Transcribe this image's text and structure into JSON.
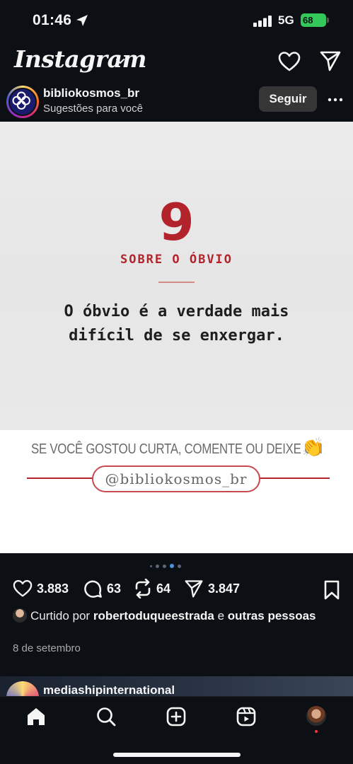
{
  "status_bar": {
    "time": "01:46",
    "network": "5G",
    "battery": "68"
  },
  "app_header": {
    "logo": "Instagram"
  },
  "post": {
    "username": "bibliokosmos_br",
    "subtitle": "Sugestões para você",
    "follow_label": "Seguir",
    "image": {
      "number": "9",
      "section_title": "SOBRE O ÓBVIO",
      "quote": "O óbvio é a verdade mais difícil de se enxergar.",
      "cta": "SE VOCÊ GOSTOU CURTA, COMENTE OU DEIXE UM",
      "cta_emoji": "👏",
      "handle": "@bibliokosmos_br",
      "accent_color": "#b3232b"
    },
    "carousel": {
      "total": 5,
      "active": 4
    },
    "stats": {
      "likes": "3.883",
      "comments": "63",
      "reposts": "64",
      "shares": "3.847"
    },
    "liked_by": {
      "prefix": "Curtido por",
      "user": "robertoduqueestrada",
      "connector": "e",
      "rest": "outras pessoas"
    },
    "date": "8 de setembro"
  },
  "next_post": {
    "username": "mediashipinternational"
  },
  "tab_bar": {
    "icons": [
      "home-icon",
      "search-icon",
      "create-icon",
      "reels-icon",
      "profile-avatar"
    ]
  }
}
